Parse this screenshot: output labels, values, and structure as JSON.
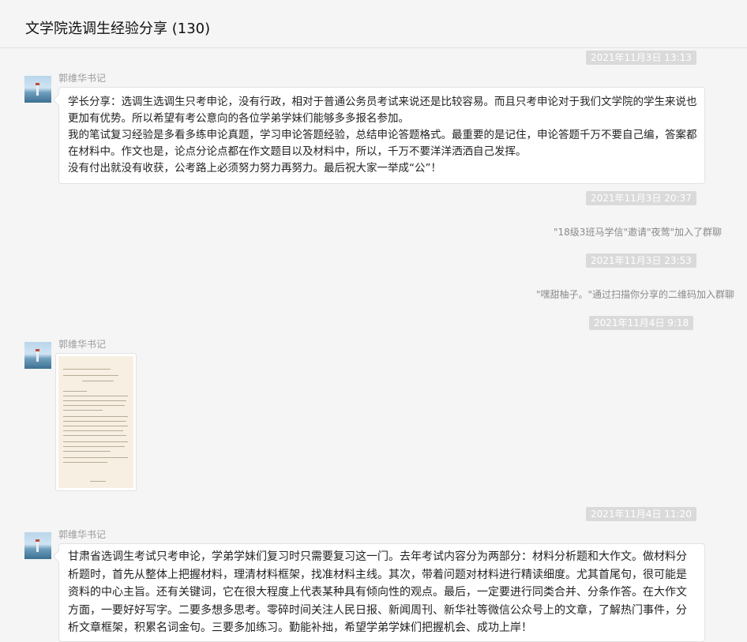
{
  "header": {
    "title": "文学院选调生经验分享 (130)"
  },
  "messages": [
    {
      "type": "time",
      "text": "2021年11月3日 13:13"
    },
    {
      "type": "text",
      "sender": "郭维华书记",
      "paragraphs": [
        "学长分享：选调生选调生只考申论，没有行政，相对于普通公务员考试来说还是比较容易。而且只考申论对于我们文学院的学生来说也更加有优势。所以希望有考公意向的各位学弟学妹们能够多多报名参加。",
        "我的笔试复习经验是多看多练申论真题，学习申论答题经验，总结申论答题格式。最重要的是记住，申论答题千万不要自己编，答案都在材料中。作文也是，论点分论点都在作文题目以及材料中，所以，千万不要洋洋洒洒自己发挥。",
        "没有付出就没有收获，公考路上必须努力努力再努力。最后祝大家一举成“公”！"
      ]
    },
    {
      "type": "time",
      "text": "2021年11月3日 20:37"
    },
    {
      "type": "system",
      "text": "\"18级3班马学信\"邀请\"夜莺\"加入了群聊"
    },
    {
      "type": "time",
      "text": "2021年11月3日 23:53"
    },
    {
      "type": "system",
      "text": "\"嘿甜柚子。\"通过扫描你分享的二维码加入群聊"
    },
    {
      "type": "time",
      "text": "2021年11月4日 9:18"
    },
    {
      "type": "image",
      "sender": "郭维华书记"
    },
    {
      "type": "time",
      "text": "2021年11月4日 11:20"
    },
    {
      "type": "text",
      "sender": "郭维华书记",
      "paragraphs": [
        "甘肃省选调生考试只考申论，学弟学妹们复习时只需要复习这一门。去年考试内容分为两部分：材料分析题和大作文。做材料分析题时，首先从整体上把握材料，理清材料框架，找准材料主线。其次，带着问题对材料进行精读细度。尤其首尾句，很可能是资料的中心主旨。还有关键词，它在很大程度上代表某种具有倾向性的观点。最后，一定要进行同类合并、分条作答。在大作文方面，一要好好写字。二要多想多思考。零碎时间关注人民日报、新闻周刊、新华社等微信公众号上的文章，了解热门事件，分析文章框架，积累名词金句。三要多加练习。勤能补拙，希望学弟学妹们把握机会、成功上岸！"
      ]
    }
  ]
}
